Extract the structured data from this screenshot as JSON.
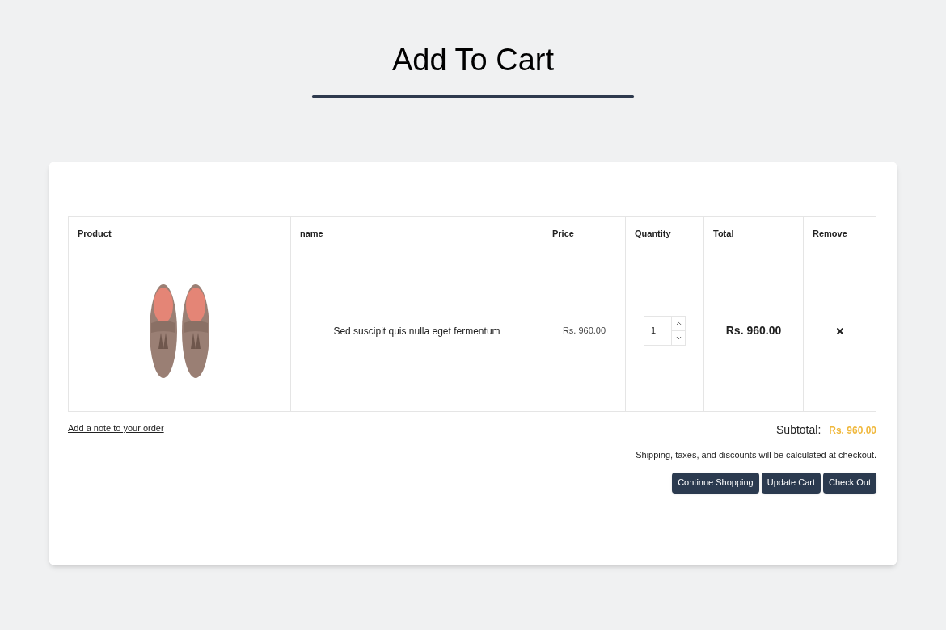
{
  "title": "Add To Cart",
  "table": {
    "columns": [
      "Product",
      "name",
      "Price",
      "Quantity",
      "Total",
      "Remove"
    ],
    "rows": [
      {
        "name": "Sed suscipit quis nulla eget fermentum",
        "price": "Rs. 960.00",
        "quantity": "1",
        "total": "Rs. 960.00"
      }
    ]
  },
  "note_link": "Add a note to your order",
  "subtotal": {
    "label": "Subtotal:",
    "value": "Rs. 960.00"
  },
  "notice": "Shipping, taxes, and discounts will be calculated at checkout.",
  "buttons": [
    "Continue Shopping",
    "Update Cart",
    "Check Out"
  ]
}
